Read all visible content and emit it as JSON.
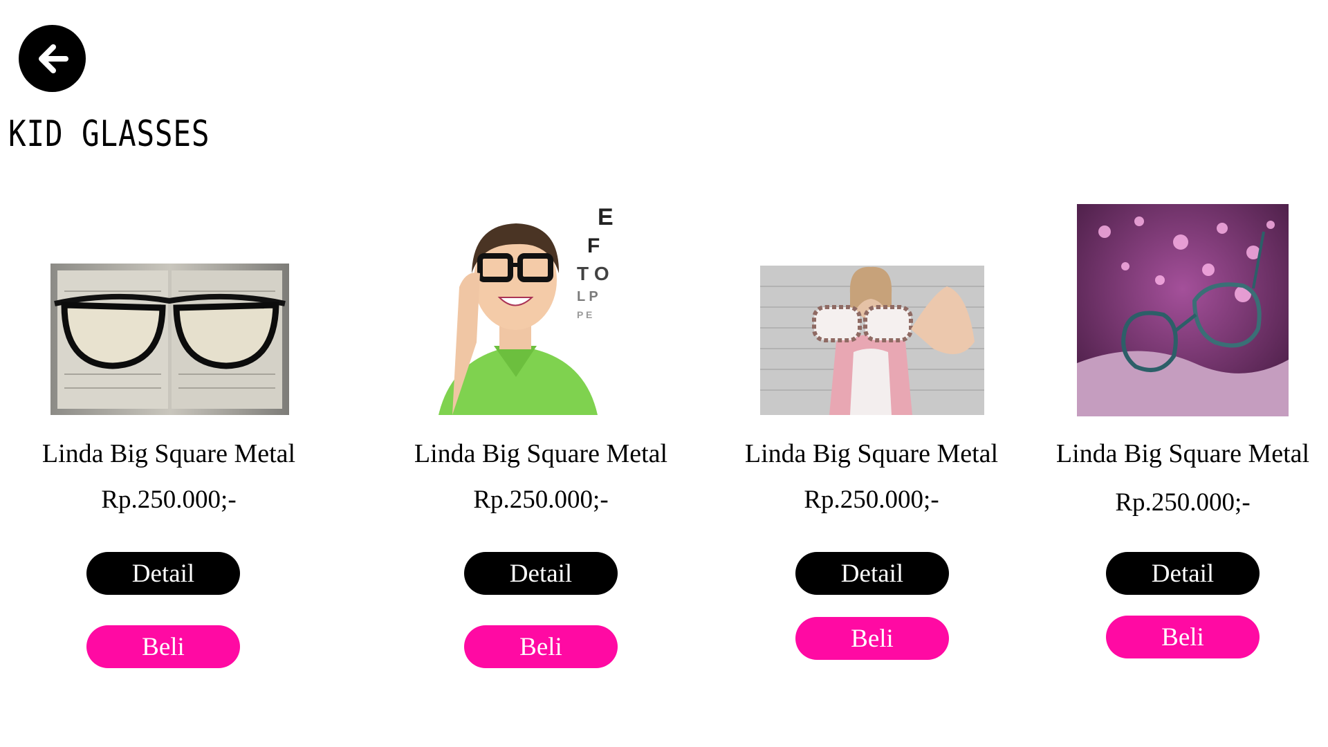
{
  "header": {
    "back_icon": "arrow-left-icon",
    "title": "KID GLASSES"
  },
  "products": [
    {
      "name": "Linda Big Square Metal",
      "price": "Rp.250.000;-",
      "detail_label": "Detail",
      "buy_label": "Beli",
      "image": "black-glasses-on-open-book"
    },
    {
      "name": "Linda Big Square Metal",
      "price": "Rp.250.000;-",
      "detail_label": "Detail",
      "buy_label": "Beli",
      "image": "boy-green-shirt-wearing-glasses-eye-chart"
    },
    {
      "name": "Linda Big Square Metal",
      "price": "Rp.250.000;-",
      "detail_label": "Detail",
      "buy_label": "Beli",
      "image": "woman-holding-tortoise-glasses"
    },
    {
      "name": "Linda Big Square Metal",
      "price": "Rp.250.000;-",
      "detail_label": "Detail",
      "buy_label": "Beli",
      "image": "glasses-pink-bokeh-lights"
    }
  ],
  "colors": {
    "buy_button": "#ff0aa3",
    "detail_button": "#000000",
    "background": "#ffffff"
  }
}
